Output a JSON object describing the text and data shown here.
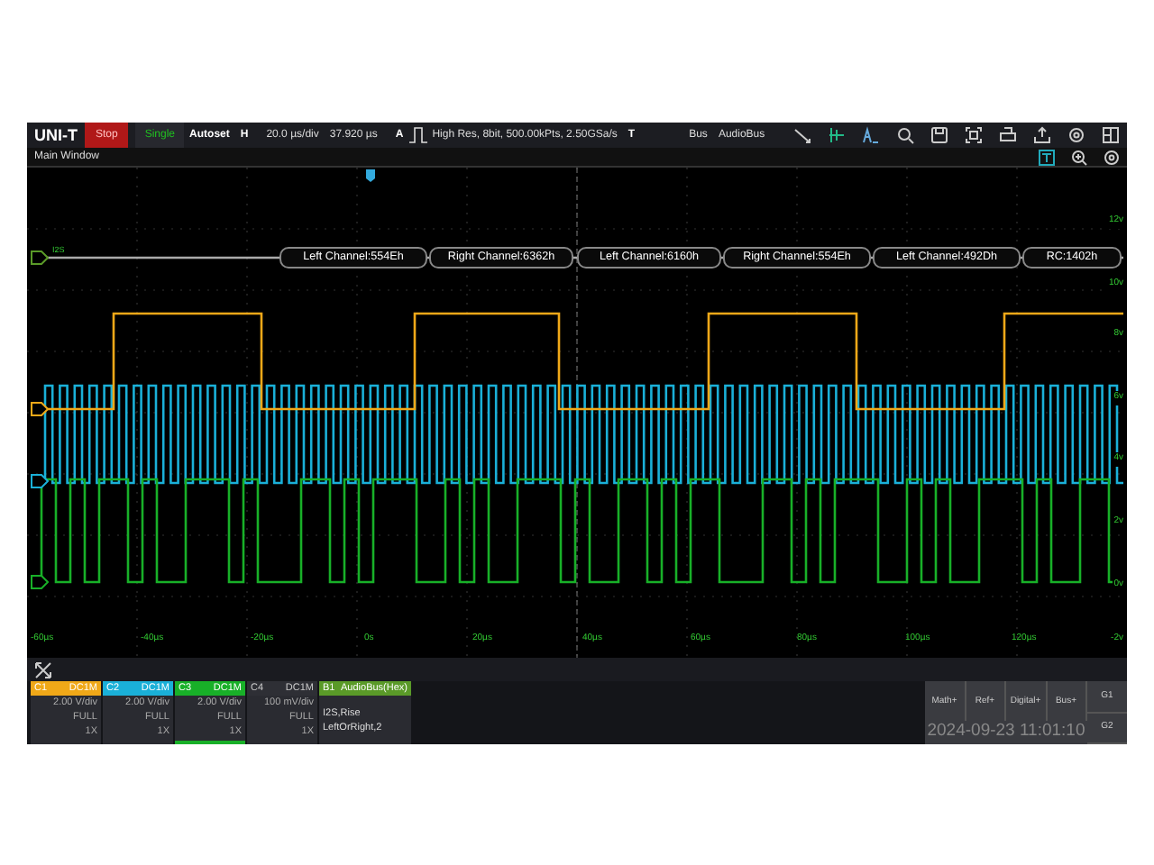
{
  "toolbar": {
    "logo": "UNI-T",
    "run_stop": "Stop",
    "single": "Single",
    "autoset": "Autoset",
    "horizontal_label": "H",
    "timebase": "20.0 µs/div",
    "delay": "37.920 µs",
    "acquire_label": "A",
    "acquisition": "High Res, 8bit, 500.00kPts, 2.50GSa/s",
    "trigger_label": "T",
    "bus_label": "Bus",
    "bus_name": "AudioBus"
  },
  "window_title": "Main Window",
  "bus_marker_label": "I2S",
  "decode_segments": [
    "Left Channel:554Eh",
    "Right Channel:6362h",
    "Left Channel:6160h",
    "Right Channel:554Eh",
    "Left Channel:492Dh",
    "RC:1402h"
  ],
  "time_axis": [
    "-60µs",
    "-40µs",
    "-20µs",
    "0s",
    "20µs",
    "40µs",
    "60µs",
    "80µs",
    "100µs",
    "120µs"
  ],
  "voltage_axis": [
    "12v",
    "10v",
    "8v",
    "6v",
    "4v",
    "2v",
    "0v",
    "-2v"
  ],
  "channels": [
    {
      "name": "C1",
      "coupling": "DC1M",
      "scale": "2.00 V/div",
      "bandwidth": "FULL",
      "probe": "1X",
      "color": "#f0a818",
      "enabled": true,
      "selected": false
    },
    {
      "name": "C2",
      "coupling": "DC1M",
      "scale": "2.00 V/div",
      "bandwidth": "FULL",
      "probe": "1X",
      "color": "#1ab0d8",
      "enabled": true,
      "selected": false
    },
    {
      "name": "C3",
      "coupling": "DC1M",
      "scale": "2.00 V/div",
      "bandwidth": "FULL",
      "probe": "1X",
      "color": "#18b028",
      "enabled": true,
      "selected": true
    },
    {
      "name": "C4",
      "coupling": "DC1M",
      "scale": "100 mV/div",
      "bandwidth": "FULL",
      "probe": "1X",
      "color": "#2e2f35",
      "enabled": false,
      "selected": false
    }
  ],
  "bus": {
    "name": "B1",
    "title": "AudioBus(Hex)",
    "lines": [
      "I2S,Rise",
      "LeftOrRight,2"
    ],
    "color": "#5a9a28"
  },
  "add_buttons": [
    "Math+",
    "Ref+",
    "Digital+",
    "Bus+"
  ],
  "datetime": "2024-09-23 11:01:10",
  "groups": [
    "G1",
    "G2"
  ]
}
